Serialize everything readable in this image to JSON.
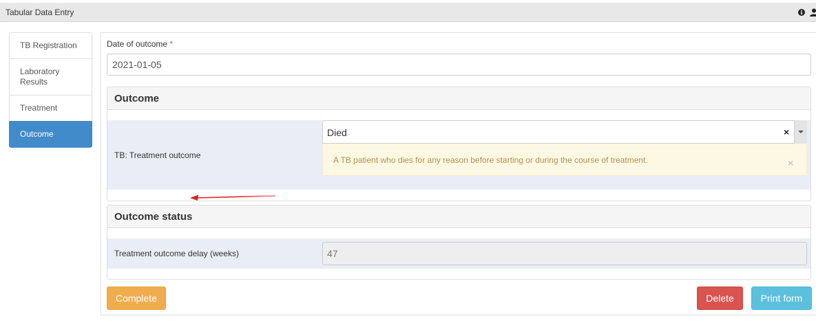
{
  "header": {
    "title": "Tabular Data Entry",
    "info_icon": "info-icon",
    "user_icon": "user-icon",
    "info_glyph": "i"
  },
  "sidebar": {
    "items": [
      {
        "label": "TB Registration",
        "active": false
      },
      {
        "label": "Laboratory Results",
        "active": false
      },
      {
        "label": "Treatment",
        "active": false
      },
      {
        "label": "Outcome",
        "active": true
      }
    ],
    "active_color": "#428bca"
  },
  "form": {
    "date_label": "Date of outcome",
    "required_mark": "*",
    "date_value": "2021-01-05",
    "outcome_panel": {
      "title": "Outcome",
      "field_label": "TB: Treatment outcome",
      "selected_value": "Died",
      "clear_glyph": "×",
      "description": "A TB patient who dies for any reason before starting or during the course of treatment.",
      "close_glyph": "×"
    },
    "status_panel": {
      "title": "Outcome status",
      "field_label": "Treatment outcome delay (weeks)",
      "value": "47"
    }
  },
  "buttons": {
    "complete": "Complete",
    "delete": "Delete",
    "print": "Print form"
  },
  "colors": {
    "complete": "#f0ad4e",
    "delete": "#d9534f",
    "print": "#5bc0de",
    "row_bg": "#e9eef6",
    "alert_bg": "#fcf8e3",
    "annotation_arrow": "#e02020"
  }
}
